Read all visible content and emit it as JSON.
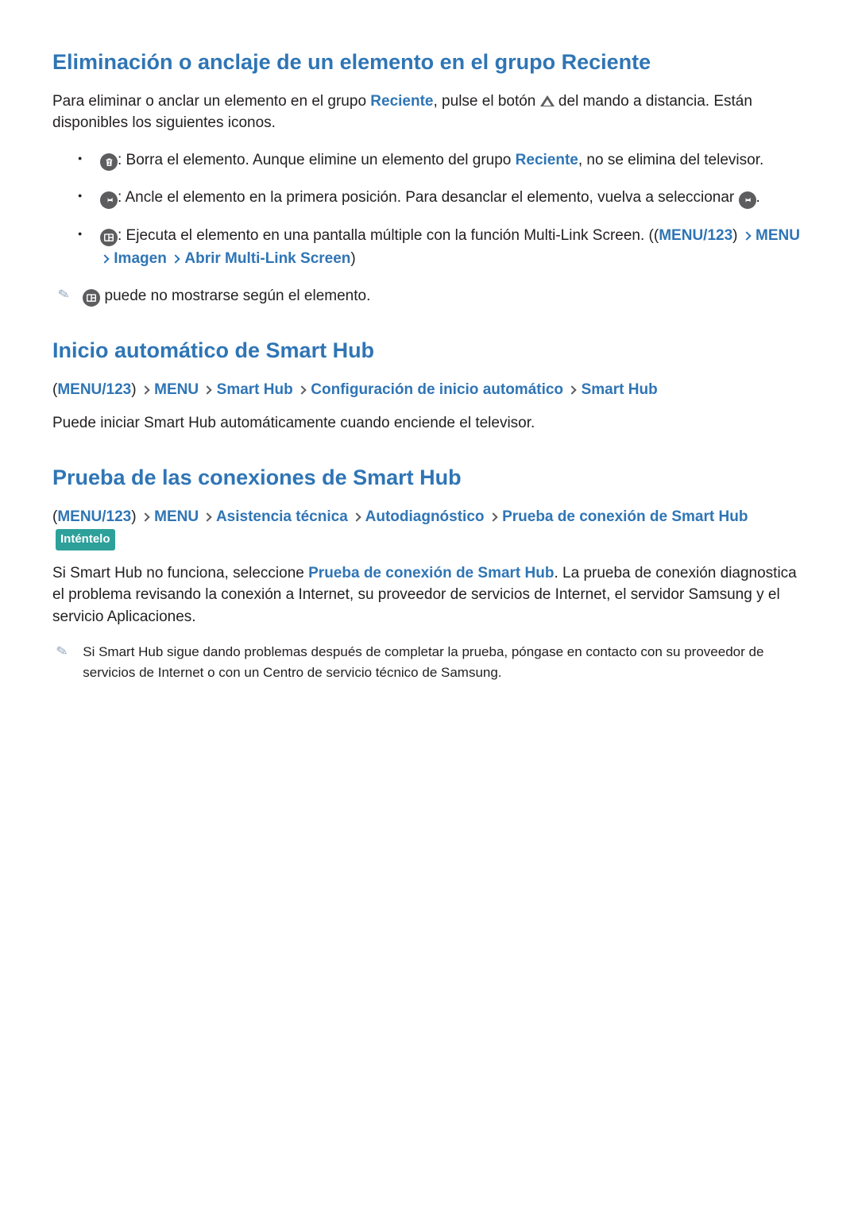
{
  "section1": {
    "title": "Eliminación o anclaje de un elemento en el grupo Reciente",
    "intro_a": "Para eliminar o anclar un elemento en el grupo ",
    "intro_kw": "Reciente",
    "intro_b": ", pulse el botón ",
    "intro_c": " del mando a distancia. Están disponibles los siguientes iconos.",
    "items": {
      "trash_a": ": Borra el elemento. Aunque elimine un elemento del grupo ",
      "trash_kw": "Reciente",
      "trash_b": ", no se elimina del televisor.",
      "pin_a": ": Ancle el elemento en la primera posición. Para desanclar el elemento, vuelva a seleccionar ",
      "pin_b": ".",
      "multi_a": ": Ejecuta el elemento en una pantalla múltiple con la función Multi-Link Screen. (",
      "multi_crumb": {
        "p0": "(",
        "p1": "MENU/123",
        "p2": ")",
        "p3": "MENU",
        "p4": "Imagen",
        "p5": "Abrir Multi-Link Screen",
        "p6": ")"
      }
    },
    "note": " puede no mostrarse según el elemento."
  },
  "section2": {
    "title": "Inicio automático de Smart Hub",
    "crumb": {
      "p0": "(",
      "p1": "MENU/123",
      "p2": ")",
      "p3": "MENU",
      "p4": "Smart Hub",
      "p5": "Configuración de inicio automático",
      "p6": "Smart Hub"
    },
    "body": "Puede iniciar Smart Hub automáticamente cuando enciende el televisor."
  },
  "section3": {
    "title": "Prueba de las conexiones de Smart Hub",
    "crumb": {
      "p0": "(",
      "p1": "MENU/123",
      "p2": ")",
      "p3": "MENU",
      "p4": "Asistencia técnica",
      "p5": "Autodiagnóstico",
      "p6": "Prueba de conexión de Smart Hub"
    },
    "try": "Inténtelo",
    "body_a": "Si Smart Hub no funciona, seleccione ",
    "body_kw": "Prueba de conexión de Smart Hub",
    "body_b": ". La prueba de conexión diagnostica el problema revisando la conexión a Internet, su proveedor de servicios de Internet, el servidor Samsung y el servicio Aplicaciones.",
    "note": "Si Smart Hub sigue dando problemas después de completar la prueba, póngase en contacto con su proveedor de servicios de Internet o con un Centro de servicio técnico de Samsung."
  }
}
